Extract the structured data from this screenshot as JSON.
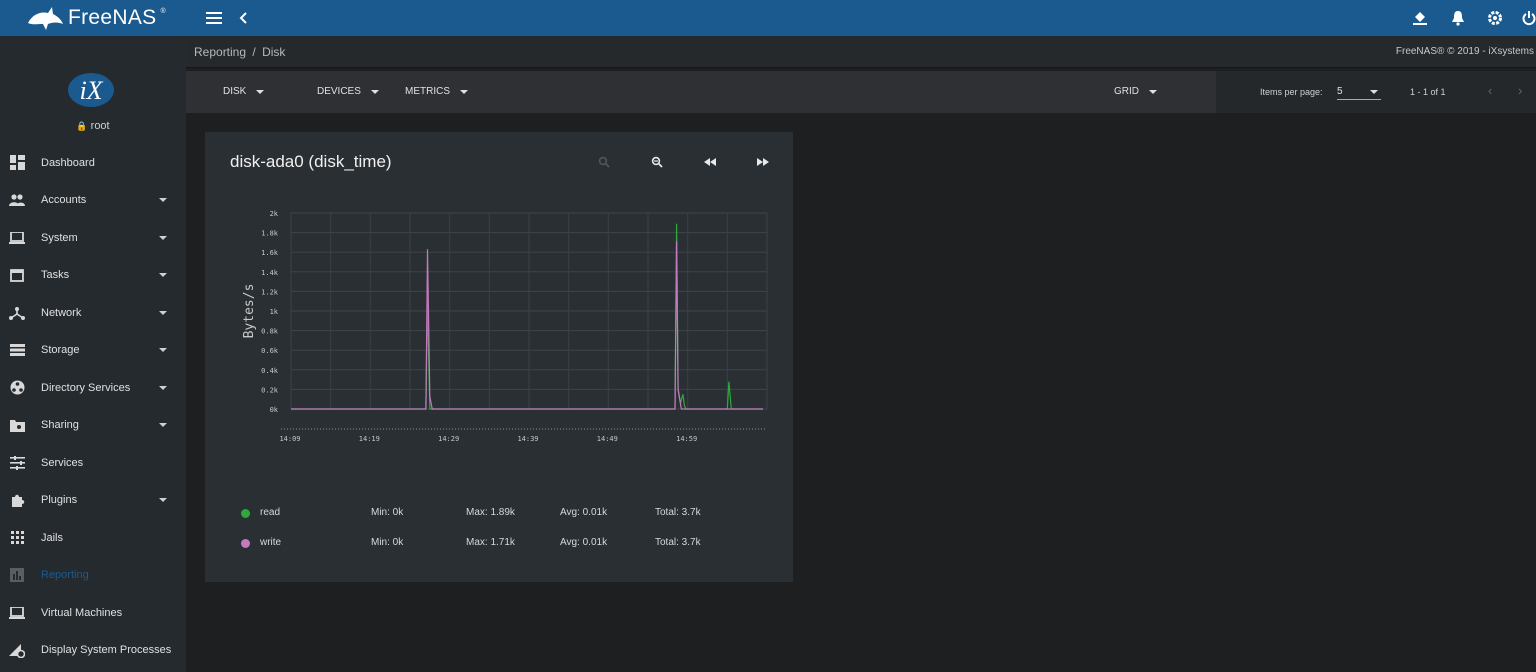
{
  "topbar": {
    "brand": "FreeNAS",
    "trademark": "®",
    "icons": [
      "menu-icon",
      "chevron-left-icon",
      "bucket-icon",
      "bell-icon",
      "gear-icon",
      "power-icon"
    ]
  },
  "sidebar": {
    "avatar_text": "iX",
    "user": "root",
    "items": [
      {
        "label": "Dashboard",
        "icon": "dashboard-icon",
        "expandable": false
      },
      {
        "label": "Accounts",
        "icon": "accounts-icon",
        "expandable": true
      },
      {
        "label": "System",
        "icon": "system-icon",
        "expandable": true
      },
      {
        "label": "Tasks",
        "icon": "tasks-icon",
        "expandable": true
      },
      {
        "label": "Network",
        "icon": "network-icon",
        "expandable": true
      },
      {
        "label": "Storage",
        "icon": "storage-icon",
        "expandable": true
      },
      {
        "label": "Directory Services",
        "icon": "directory-services-icon",
        "expandable": true
      },
      {
        "label": "Sharing",
        "icon": "sharing-icon",
        "expandable": true
      },
      {
        "label": "Services",
        "icon": "services-icon",
        "expandable": false
      },
      {
        "label": "Plugins",
        "icon": "plugins-icon",
        "expandable": true
      },
      {
        "label": "Jails",
        "icon": "jails-icon",
        "expandable": false
      },
      {
        "label": "Reporting",
        "icon": "reporting-icon",
        "expandable": false,
        "active": true
      },
      {
        "label": "Virtual Machines",
        "icon": "virtual-machines-icon",
        "expandable": false
      },
      {
        "label": "Display System Processes",
        "icon": "processes-icon",
        "expandable": false
      }
    ]
  },
  "breadcrumb": {
    "parent": "Reporting",
    "separator": "/",
    "current": "Disk"
  },
  "copyright": "FreeNAS® © 2019 - iXsystems",
  "toolbar": {
    "disk_label": "DISK",
    "devices_label": "DEVICES",
    "metrics_label": "METRICS",
    "grid_label": "GRID",
    "items_per_page_label": "Items per page:",
    "items_per_page_value": "5",
    "range_label": "1 - 1 of 1"
  },
  "card": {
    "title": "disk-ada0 (disk_time)",
    "buttons": [
      "zoom-in-icon",
      "zoom-out-icon",
      "rewind-icon",
      "fast-forward-icon"
    ]
  },
  "chart_data": {
    "type": "line",
    "ylabel": "Bytes/s",
    "xlabel": "",
    "ylim": [
      0,
      2000
    ],
    "y_ticks": [
      "0k",
      "0.2k",
      "0.4k",
      "0.6k",
      "0.8k",
      "1k",
      "1.2k",
      "1.4k",
      "1.6k",
      "1.8k",
      "2k"
    ],
    "x_ticks": [
      "14:09",
      "14:19",
      "14:29",
      "14:39",
      "14:49",
      "14:59"
    ],
    "x_range_minutes": [
      0,
      60
    ],
    "grid": true,
    "series": [
      {
        "name": "read",
        "color": "#2eaa3c",
        "x": [
          0,
          17.0,
          17.2,
          17.5,
          48.4,
          48.6,
          48.8,
          49.1,
          49.4,
          49.6,
          49.8,
          55.0,
          55.2,
          55.5,
          59.5
        ],
        "y": [
          0,
          0,
          1100,
          0,
          0,
          1890,
          200,
          60,
          150,
          30,
          0,
          0,
          280,
          0,
          0
        ],
        "min": "Min: 0k",
        "max": "Max: 1.89k",
        "avg": "Avg: 0.01k",
        "total": "Total: 3.7k"
      },
      {
        "name": "write",
        "color": "#c47ac0",
        "x": [
          0,
          17.0,
          17.2,
          17.5,
          17.8,
          48.4,
          48.6,
          48.8,
          49.2,
          59.5
        ],
        "y": [
          0,
          0,
          1630,
          130,
          0,
          0,
          1710,
          200,
          0,
          0
        ],
        "min": "Min: 0k",
        "max": "Max: 1.71k",
        "avg": "Avg: 0.01k",
        "total": "Total: 3.7k"
      }
    ]
  }
}
